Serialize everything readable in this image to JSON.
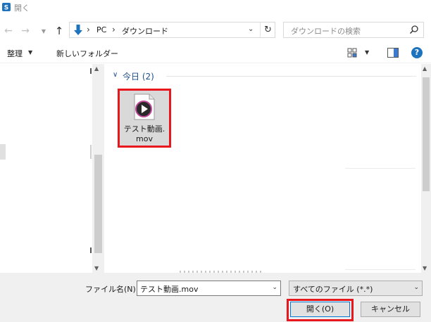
{
  "window": {
    "title": "開く"
  },
  "nav": {
    "back_icon": "arrow-left-icon",
    "forward_icon": "arrow-right-icon",
    "recent_icon": "chevron-down-icon",
    "up_icon": "arrow-up-icon",
    "address": {
      "segment1": "PC",
      "segment2": "ダウンロード",
      "refresh_icon": "refresh-icon"
    },
    "search": {
      "placeholder": "ダウンロードの検索"
    }
  },
  "toolbar": {
    "organize_label": "整理",
    "new_folder_label": "新しいフォルダー"
  },
  "content": {
    "group_header": "今日 (2)",
    "files": [
      {
        "name": "テスト動画.mov",
        "name_line1": "テスト動画.",
        "name_line2": "mov",
        "selected": true
      }
    ]
  },
  "bottom": {
    "filename_label": "ファイル名(N):",
    "filename_value": "テスト動画.mov",
    "filetype_value": "すべてのファイル (*.*)",
    "open_button": "開く(O)",
    "cancel_button": "キャンセル"
  },
  "colors": {
    "highlight": "#e8161d",
    "accent_blue": "#1e73be",
    "selection": "#cce4f7"
  }
}
